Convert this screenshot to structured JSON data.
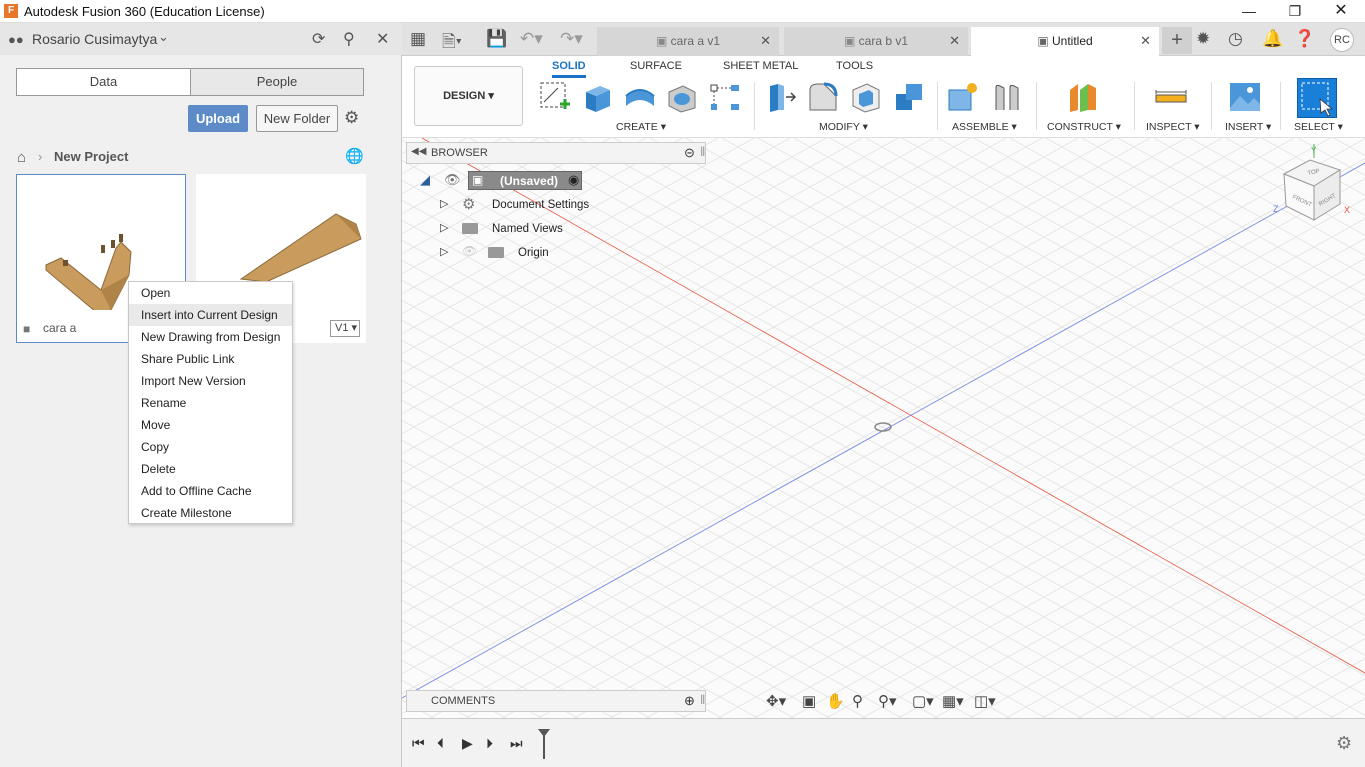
{
  "window": {
    "title": "Autodesk Fusion 360 (Education License)",
    "app_icon_letter": "F"
  },
  "left_panel": {
    "user_name": "Rosario Cusimaytya",
    "tabs": [
      {
        "label": "Data"
      },
      {
        "label": "People"
      }
    ],
    "upload_label": "Upload",
    "new_folder_label": "New Folder",
    "breadcrumb_project": "New Project",
    "cards": [
      {
        "name": "cara a",
        "version": ""
      },
      {
        "name": "",
        "version": "V1"
      }
    ],
    "context_menu": [
      {
        "label": "Open"
      },
      {
        "label": "Insert into Current Design"
      },
      {
        "label": "New Drawing from Design"
      },
      {
        "label": "Share Public Link"
      },
      {
        "label": "Import New Version"
      },
      {
        "label": "Rename"
      },
      {
        "label": "Move"
      },
      {
        "label": "Copy"
      },
      {
        "label": "Delete"
      },
      {
        "label": "Add to Offline Cache"
      },
      {
        "label": "Create Milestone"
      }
    ]
  },
  "doc_tabs": [
    {
      "label": "cara a v1"
    },
    {
      "label": "cara b v1"
    },
    {
      "label": "Untitled"
    }
  ],
  "user_initials": "RC",
  "toolbar": {
    "workspace": "DESIGN",
    "ribbon_tabs": [
      "SOLID",
      "SURFACE",
      "SHEET METAL",
      "TOOLS"
    ],
    "groups": [
      "CREATE",
      "MODIFY",
      "ASSEMBLE",
      "CONSTRUCT",
      "INSPECT",
      "INSERT",
      "SELECT"
    ]
  },
  "browser": {
    "title": "BROWSER",
    "root": "(Unsaved)",
    "items": [
      "Document Settings",
      "Named Views",
      "Origin"
    ]
  },
  "comments_label": "COMMENTS",
  "viewcube": {
    "top": "TOP",
    "front": "FRONT",
    "right": "RIGHT",
    "x": "X",
    "y": "Y",
    "z": "Z"
  },
  "colors": {
    "accent": "#1a73c9",
    "upload": "#5c8bc8",
    "x_axis": "#e8553e",
    "y_axis": "#6a7fe0"
  }
}
